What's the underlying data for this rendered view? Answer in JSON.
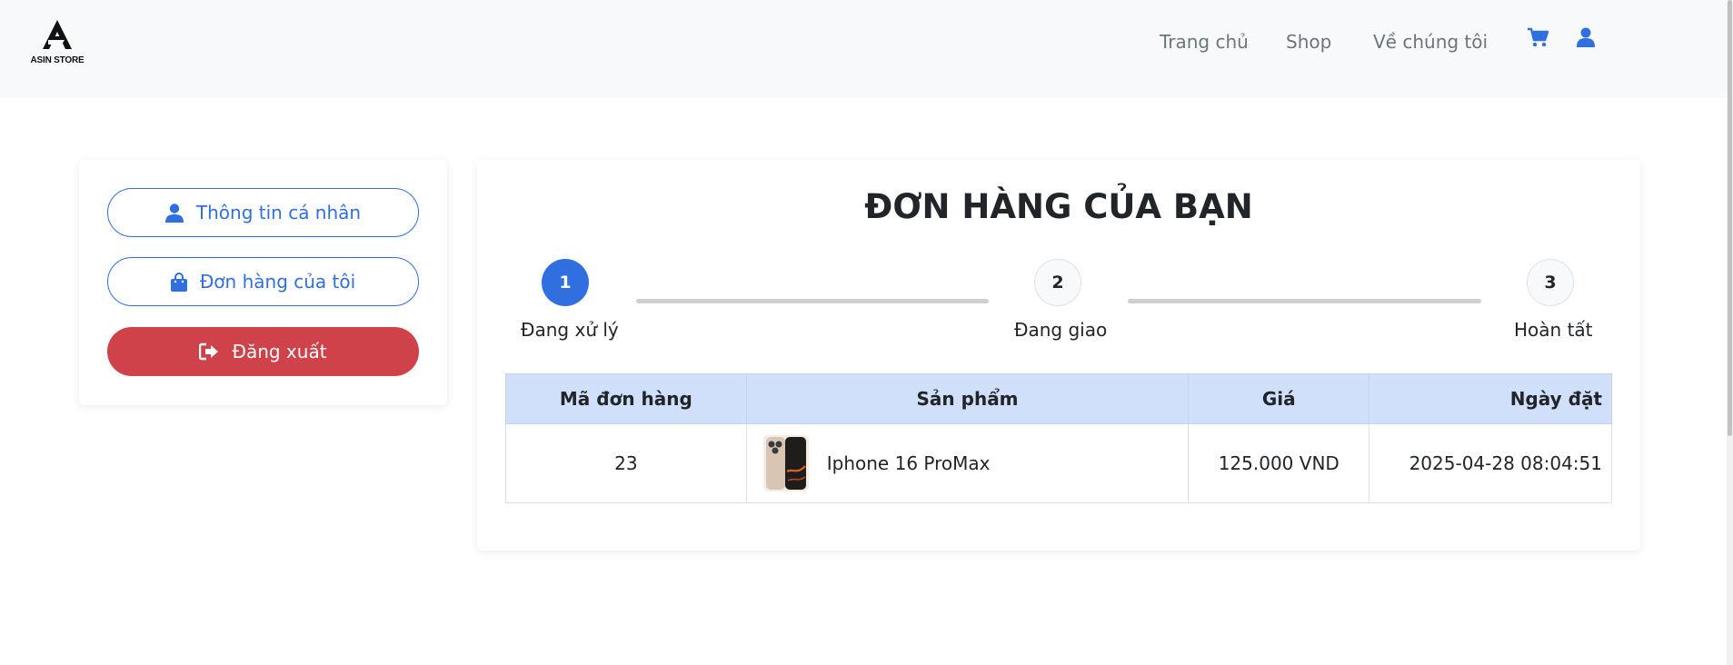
{
  "brand": {
    "name": "ASIN STORE",
    "logo_icon": "asin-logo-icon"
  },
  "nav": {
    "links": [
      "Trang chủ",
      "Shop",
      "Về chúng tôi"
    ],
    "icons": [
      "cart-icon",
      "user-icon"
    ],
    "accent": "#2f6fe0"
  },
  "sidebar": {
    "profile_label": "Thông tin cá nhân",
    "orders_label": "Đơn hàng của tôi",
    "logout_label": "Đăng xuất",
    "logout_color": "#cf4249"
  },
  "main": {
    "title": "ĐƠN HÀNG CỦA BẠN",
    "steps": [
      {
        "number": "1",
        "label": "Đang xử lý",
        "active": true
      },
      {
        "number": "2",
        "label": "Đang giao",
        "active": false
      },
      {
        "number": "3",
        "label": "Hoàn tất",
        "active": false
      }
    ],
    "table": {
      "headers": [
        "Mã đơn hàng",
        "Sản phẩm",
        "Giá",
        "Ngày đặt"
      ],
      "rows": [
        {
          "order_id": "23",
          "product": "Iphone 16 ProMax",
          "price": "125.000 VND",
          "date": "2025-04-28 08:04:51"
        }
      ]
    }
  }
}
